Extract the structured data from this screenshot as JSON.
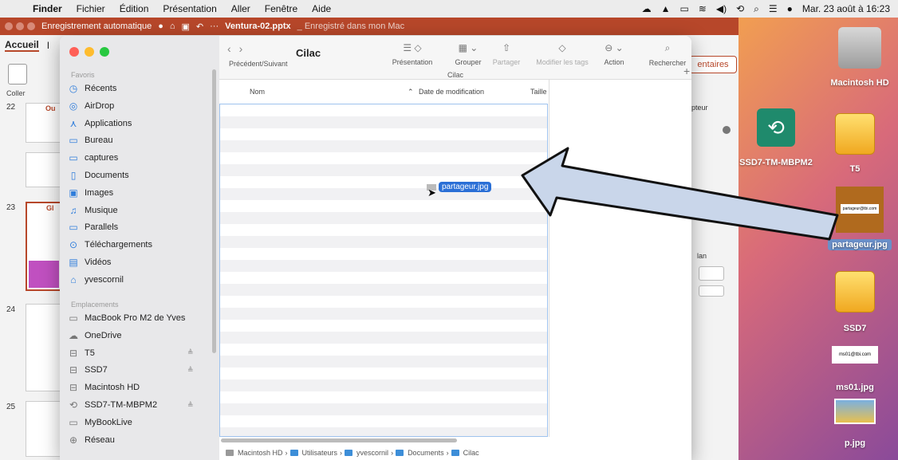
{
  "menubar": {
    "apple": "",
    "items": [
      "Finder",
      "Fichier",
      "Édition",
      "Présentation",
      "Aller",
      "Fenêtre",
      "Aide"
    ],
    "clock": "Mar. 23 août à 16:23"
  },
  "ppt": {
    "autosave": "Enregistrement automatique",
    "doc_name": "Ventura-02.pptx",
    "saved_status": "_ Enregistré dans mon Mac",
    "tabs": [
      "Accueil",
      "I"
    ],
    "coller": "Coller",
    "slides": [
      {
        "num": "22",
        "title": "Ou"
      },
      {
        "num": "23",
        "title": "Gl"
      },
      {
        "num": "24",
        "title": ""
      },
      {
        "num": "25",
        "title": ""
      }
    ],
    "commentaires": "entaires",
    "epteur": "epteur",
    "lan": "lan"
  },
  "finder": {
    "sidebar": {
      "favoris_label": "Favoris",
      "favoris": [
        {
          "label": "Récents",
          "icon": "clock-icon"
        },
        {
          "label": "AirDrop",
          "icon": "airdrop-icon"
        },
        {
          "label": "Applications",
          "icon": "applications-icon"
        },
        {
          "label": "Bureau",
          "icon": "desktop-icon"
        },
        {
          "label": "captures",
          "icon": "folder-icon"
        },
        {
          "label": "Documents",
          "icon": "document-icon"
        },
        {
          "label": "Images",
          "icon": "images-icon"
        },
        {
          "label": "Musique",
          "icon": "music-icon"
        },
        {
          "label": "Parallels",
          "icon": "folder-icon"
        },
        {
          "label": "Téléchargements",
          "icon": "download-icon"
        },
        {
          "label": "Vidéos",
          "icon": "video-icon"
        },
        {
          "label": "yvescornil",
          "icon": "home-icon"
        }
      ],
      "emplacements_label": "Emplacements",
      "emplacements": [
        {
          "label": "MacBook Pro M2 de Yves",
          "icon": "laptop-icon",
          "eject": ""
        },
        {
          "label": "OneDrive",
          "icon": "cloud-icon",
          "eject": ""
        },
        {
          "label": "T5",
          "icon": "drive-icon",
          "eject": "≜"
        },
        {
          "label": "SSD7",
          "icon": "drive-icon",
          "eject": "≜"
        },
        {
          "label": "Macintosh HD",
          "icon": "drive-icon",
          "eject": ""
        },
        {
          "label": "SSD7-TM-MBPM2",
          "icon": "timemachine-icon",
          "eject": "≜"
        },
        {
          "label": "MyBookLive",
          "icon": "display-icon",
          "eject": ""
        },
        {
          "label": "Réseau",
          "icon": "network-icon",
          "eject": ""
        }
      ]
    },
    "toolbar": {
      "nav_label": "Précédent/Suivant",
      "title": "Cilac",
      "presentation": "Présentation",
      "grouper": "Grouper",
      "partager": "Partager",
      "modifier_tags": "Modifier les tags",
      "action": "Action",
      "rechercher": "Rechercher"
    },
    "column_title": "Cilac",
    "columns": {
      "nom": "Nom",
      "date": "Date de modification",
      "taille": "Taille"
    },
    "dragged_file": "partageur.jpg",
    "pathbar": [
      "Macintosh HD",
      "Utilisateurs",
      "yvescornil",
      "Documents",
      "Cilac"
    ]
  },
  "desktop": {
    "icons": [
      {
        "label": "Macintosh HD"
      },
      {
        "label": "SSD7-TM-MBPM2"
      },
      {
        "label": "T5"
      },
      {
        "label": "partageur.jpg",
        "thumb_text": "partageur@tbi.com"
      },
      {
        "label": "SSD7"
      },
      {
        "label": "ms01.jpg",
        "thumb_text": "ms01@tbi.com"
      },
      {
        "label": "p.jpg"
      }
    ]
  },
  "colors": {
    "ppt_accent": "#b7472a",
    "selection": "#2a6fd6",
    "arrow_fill": "#c9d6ea"
  }
}
